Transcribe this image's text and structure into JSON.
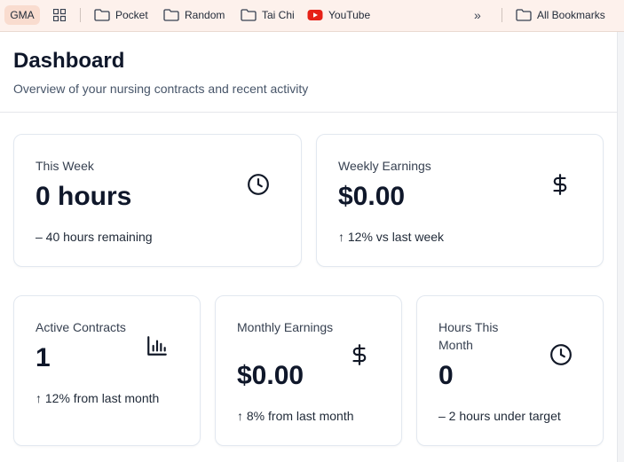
{
  "bookmarks": {
    "badge": "GMA",
    "items": [
      {
        "label": "Pocket",
        "icon": "folder-icon"
      },
      {
        "label": "Random",
        "icon": "folder-icon"
      },
      {
        "label": "Tai Chi",
        "icon": "folder-icon"
      },
      {
        "label": "YouTube",
        "icon": "youtube-icon"
      }
    ],
    "more": "»",
    "all_bookmarks": "All Bookmarks"
  },
  "header": {
    "title": "Dashboard",
    "subtitle": "Overview of your nursing contracts and recent activity"
  },
  "cards": {
    "this_week": {
      "label": "This Week",
      "value": "0 hours",
      "note": "– 40 hours remaining",
      "icon": "clock-icon"
    },
    "weekly_earnings": {
      "label": "Weekly Earnings",
      "value": "$0.00",
      "note": "↑ 12% vs last week",
      "icon": "dollar-icon"
    },
    "active_contracts": {
      "label": "Active Contracts",
      "value": "1",
      "note": "↑ 12% from last month",
      "icon": "bar-chart-icon"
    },
    "monthly_earnings": {
      "label": "Monthly Earnings",
      "value": "$0.00",
      "note": "↑ 8% from last month",
      "icon": "dollar-icon"
    },
    "hours_this_month": {
      "label": "Hours This Month",
      "value": "0",
      "note": "– 2 hours under target",
      "icon": "clock-icon"
    }
  },
  "colors": {
    "bookmarks_bar_bg": "#fdf1ec",
    "card_border": "#e2e8f0",
    "text_primary": "#0f172a",
    "youtube_red": "#e62117"
  }
}
